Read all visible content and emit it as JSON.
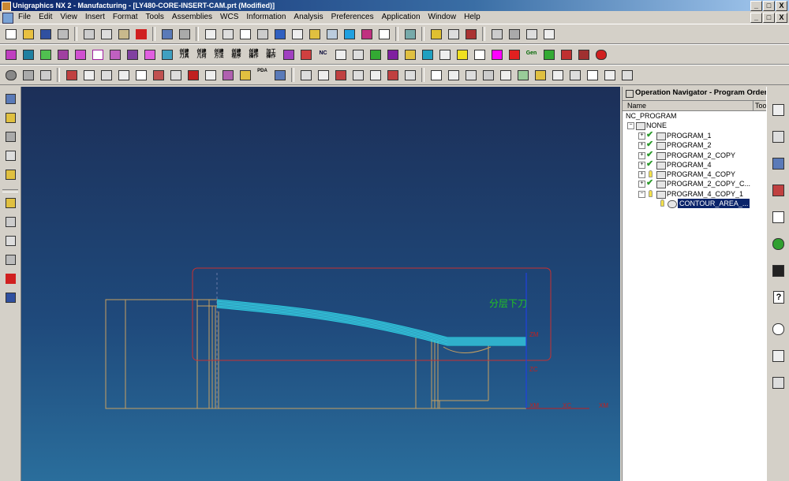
{
  "window": {
    "title": "Unigraphics NX 2 - Manufacturing - [LY480-CORE-INSERT-CAM.prt (Modified)]",
    "buttons": [
      "_",
      "□",
      "X"
    ]
  },
  "menu": {
    "items": [
      "File",
      "Edit",
      "View",
      "Insert",
      "Format",
      "Tools",
      "Assemblies",
      "WCS",
      "Information",
      "Analysis",
      "Preferences",
      "Application",
      "Window",
      "Help"
    ],
    "doc_buttons": [
      "_",
      "□",
      "X"
    ]
  },
  "toolbar_text_icons": [
    "创建刀具",
    "创建几何",
    "创建方法",
    "创建程序",
    "创建操作",
    "加工操作"
  ],
  "toolbar_text_icons2": [
    "NC",
    "Gen"
  ],
  "toolbar_text_icons3": [
    "PDA"
  ],
  "navigator": {
    "title": "Operation Navigator - Program Order",
    "columns": {
      "name": "Name",
      "tool": "Tool"
    },
    "root": "NC_PROGRAM",
    "none": "NONE",
    "programs": [
      {
        "label": "PROGRAM_1",
        "status": "check"
      },
      {
        "label": "PROGRAM_2",
        "status": "check"
      },
      {
        "label": "PROGRAM_2_COPY",
        "status": "check"
      },
      {
        "label": "PROGRAM_4",
        "status": "check"
      },
      {
        "label": "PROGRAM_4_COPY",
        "status": "bulb"
      },
      {
        "label": "PROGRAM_2_COPY_C...",
        "status": "check"
      },
      {
        "label": "PROGRAM_4_COPY_1",
        "status": "bulb"
      }
    ],
    "selected_operation": "CONTOUR_AREA_..."
  },
  "viewport": {
    "annotation": "分层下刀",
    "axis_labels": {
      "zm": "ZM",
      "zc": "ZC",
      "xm_left": "XM",
      "xc": "XC",
      "xm_right": "XM"
    }
  },
  "colors": {
    "viewport_top": "#1c2f58",
    "viewport_bottom": "#2a6e9c",
    "toolpath": "#28d8e8",
    "selection_box": "#c83030",
    "annotation": "#22c422",
    "part_outline": "#c8a060"
  }
}
